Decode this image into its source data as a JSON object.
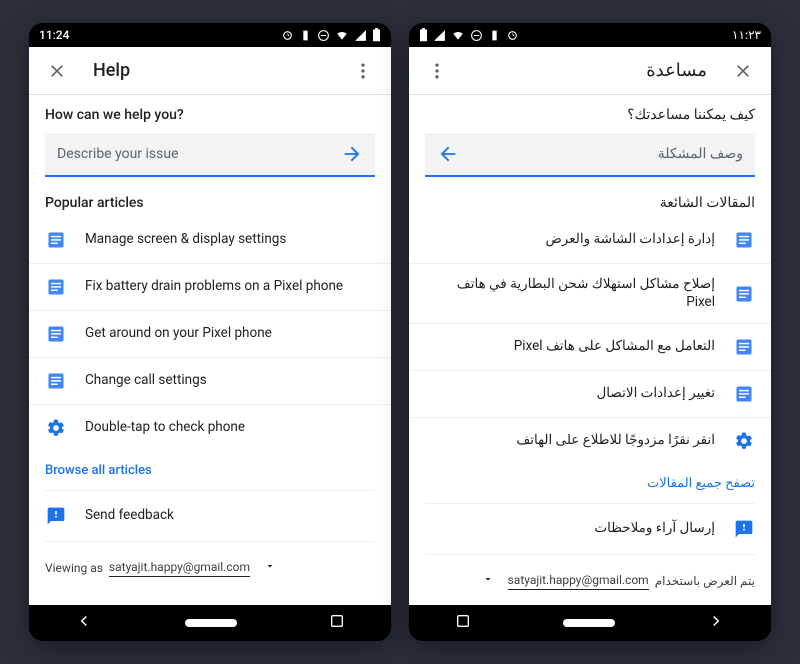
{
  "ltr": {
    "status_time": "11:24",
    "appbar_title": "Help",
    "prompt": "How can we help you?",
    "search_placeholder": "Describe your issue",
    "section_title": "Popular articles",
    "articles": [
      {
        "icon": "article",
        "label": "Manage screen & display settings"
      },
      {
        "icon": "article",
        "label": "Fix battery drain problems on a Pixel phone"
      },
      {
        "icon": "article",
        "label": "Get around on your Pixel phone"
      },
      {
        "icon": "article",
        "label": "Change call settings"
      },
      {
        "icon": "gear",
        "label": "Double-tap to check phone"
      }
    ],
    "browse_label": "Browse all articles",
    "feedback_label": "Send feedback",
    "viewing_prefix": "Viewing as",
    "viewing_email": "satyajit.happy@gmail.com"
  },
  "rtl": {
    "status_time": "١١:٢٣",
    "appbar_title": "مساعدة",
    "prompt": "كيف يمكننا مساعدتك؟",
    "search_placeholder": "وصف المشكلة",
    "section_title": "المقالات الشائعة",
    "articles": [
      {
        "icon": "article",
        "label": "إدارة إعدادات الشاشة والعرض"
      },
      {
        "icon": "article",
        "label": "إصلاح مشاكل استهلاك شحن البطارية في هاتف Pixel"
      },
      {
        "icon": "article",
        "label": "التعامل مع المشاكل على هاتف Pixel"
      },
      {
        "icon": "article",
        "label": "تغيير إعدادات الاتصال"
      },
      {
        "icon": "gear",
        "label": "انقر نقرًا مزدوجًا للاطلاع على الهاتف"
      }
    ],
    "browse_label": "تصفح جميع المقالات",
    "feedback_label": "إرسال آراء وملاحظات",
    "viewing_prefix": "يتم العرض باستخدام",
    "viewing_email": "satyajit.happy@gmail.com"
  }
}
